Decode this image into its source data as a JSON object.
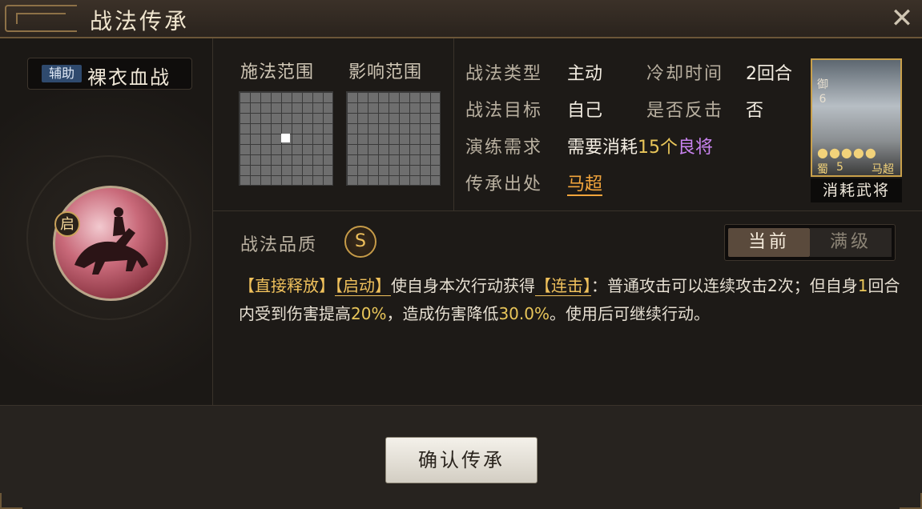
{
  "window": {
    "title": "战法传承",
    "close_glyph": "✕"
  },
  "skill": {
    "role_tag": "辅助",
    "name": "裸衣血战",
    "start_badge": "启",
    "icon": "horse-rider-icon"
  },
  "range": {
    "cast_label": "施法范围",
    "effect_label": "影响范围"
  },
  "info": {
    "type_label": "战法类型",
    "type_value": "主动",
    "cooldown_label": "冷却时间",
    "cooldown_value": "2回合",
    "target_label": "战法目标",
    "target_value": "自己",
    "counter_label": "是否反击",
    "counter_value": "否",
    "drill_label": "演练需求",
    "drill_prefix": "需要消耗",
    "drill_count": "15个",
    "drill_quality": "良将",
    "origin_label": "传承出处",
    "origin_value": "马超"
  },
  "hero": {
    "side_rank": "御",
    "side_level": "6",
    "stars": "●●●●●",
    "faction": "蜀",
    "cost": "5",
    "name": "马超",
    "caption": "消耗武将"
  },
  "quality": {
    "label": "战法品质",
    "grade": "S"
  },
  "toggle": {
    "current": "当前",
    "max": "满级"
  },
  "description": {
    "tag1": "【直接释放】",
    "tag2": "【启动】",
    "text1": "使自身本次行动获得",
    "tag3": "【连击】",
    "text2": "：普通攻击可以连续攻击2次；但自身",
    "num1": "1",
    "text3": "回合内受到伤害提高",
    "num2": "20%",
    "text4": "，造成伤害降低",
    "num3": "30.0%",
    "text5": "。使用后可继续行动。"
  },
  "confirm": {
    "label": "确认传承"
  },
  "colors": {
    "accent_gold": "#f0c15c",
    "link_orange": "#f2a53c",
    "quality_purple": "#c983f0"
  }
}
